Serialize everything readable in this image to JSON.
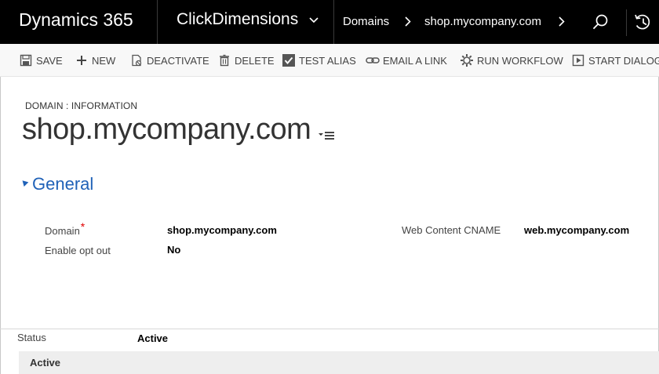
{
  "topbar": {
    "brand": "Dynamics 365",
    "app_name": "ClickDimensions",
    "breadcrumbs": [
      "Domains",
      "shop.mycompany.com"
    ],
    "icons": [
      "chevron-down-icon",
      "chevron-right-icon",
      "search-icon",
      "history-icon"
    ]
  },
  "commands": {
    "save": "SAVE",
    "new": "NEW",
    "deactivate": "DEACTIVATE",
    "delete": "DELETE",
    "test_alias": "TEST ALIAS",
    "email_link": "EMAIL A LINK",
    "run_workflow": "RUN WORKFLOW",
    "start_dialog": "START DIALOG"
  },
  "record": {
    "entity_label": "DOMAIN : INFORMATION",
    "title": "shop.mycompany.com"
  },
  "section": {
    "title": "General"
  },
  "fields": {
    "domain_label": "Domain",
    "domain_required": "*",
    "domain_value": "shop.mycompany.com",
    "opt_out_label": "Enable opt out",
    "opt_out_value": "No",
    "cname_label": "Web Content CNAME",
    "cname_value": "web.mycompany.com"
  },
  "footer": {
    "status_label": "Status",
    "status_value": "Active",
    "status_bar_text": "Active"
  },
  "colors": {
    "nav_bg": "#000000",
    "accent": "#2062b8",
    "required": "#e00000"
  }
}
